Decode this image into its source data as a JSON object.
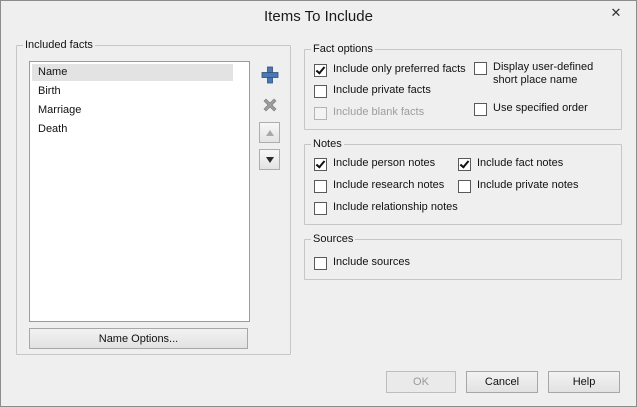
{
  "window": {
    "title": "Items To Include",
    "close_glyph": "✕"
  },
  "included_facts": {
    "legend": "Included facts",
    "items": [
      "Name",
      "Birth",
      "Marriage",
      "Death"
    ],
    "selected_index": 0,
    "name_options_button": "Name Options..."
  },
  "side_buttons": {
    "add_icon": "plus-icon",
    "remove_icon": "x-icon",
    "up_icon": "arrow-up-icon",
    "down_icon": "arrow-down-icon"
  },
  "fact_options": {
    "legend": "Fact options",
    "only_preferred": {
      "label": "Include only preferred facts",
      "checked": true
    },
    "private_facts": {
      "label": "Include private facts",
      "checked": false
    },
    "blank_facts": {
      "label": "Include blank facts",
      "checked": false,
      "disabled": true
    },
    "short_place": {
      "label_line1": "Display user-defined",
      "label_line2": "short place name",
      "checked": false
    },
    "specified_order": {
      "label": "Use specified order",
      "checked": false
    }
  },
  "notes": {
    "legend": "Notes",
    "person_notes": {
      "label": "Include person notes",
      "checked": true
    },
    "research_notes": {
      "label": "Include research notes",
      "checked": false
    },
    "relationship_notes": {
      "label": "Include relationship notes",
      "checked": false
    },
    "fact_notes": {
      "label": "Include fact notes",
      "checked": true
    },
    "private_notes": {
      "label": "Include private notes",
      "checked": false
    }
  },
  "sources": {
    "legend": "Sources",
    "include_sources": {
      "label": "Include sources",
      "checked": false
    }
  },
  "footer": {
    "ok": "OK",
    "cancel": "Cancel",
    "help": "Help"
  }
}
